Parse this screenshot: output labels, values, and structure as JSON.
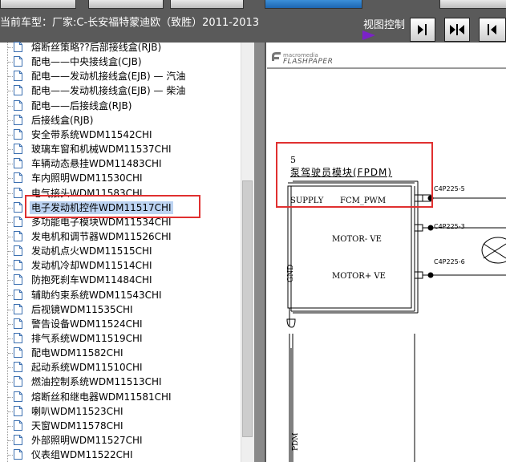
{
  "header": {
    "vehicle_text": "当前车型：厂家:C-长安福特蒙迪欧（致胜）2011-2013",
    "view_control_label": "视图控制"
  },
  "tree": {
    "items": [
      {
        "label": "熔断丝策略??后部接线盒(RJB)"
      },
      {
        "label": "配电——中央接线盒(CJB)"
      },
      {
        "label": "配电——发动机接线盒(EJB) — 汽油"
      },
      {
        "label": "配电——发动机接线盒(EJB) — 柴油"
      },
      {
        "label": "配电——后接线盒(RJB)"
      },
      {
        "label": "后接线盒(RJB)"
      },
      {
        "label": "安全带系统WDM11542CHI"
      },
      {
        "label": "玻璃车窗和机械WDM11537CHI"
      },
      {
        "label": "车辆动态悬挂WDM11483CHI"
      },
      {
        "label": "车内照明WDM11530CHI"
      },
      {
        "label": "电气接头WDM11583CHI"
      },
      {
        "label": "电子发动机控件WDM11517CHI",
        "selected": true
      },
      {
        "label": "多功能电子模块WDM11534CHI"
      },
      {
        "label": "发电机和调节器WDM11526CHI"
      },
      {
        "label": "发动机点火WDM11515CHI"
      },
      {
        "label": "发动机冷却WDM11514CHI"
      },
      {
        "label": "防抱死刹车WDM11484CHI"
      },
      {
        "label": "辅助约束系统WDM11543CHI"
      },
      {
        "label": "后视镜WDM11535CHI"
      },
      {
        "label": "警告设备WDM11524CHI"
      },
      {
        "label": "排气系统WDM11519CHI"
      },
      {
        "label": "配电WDM11582CHI"
      },
      {
        "label": "起动系统WDM11510CHI"
      },
      {
        "label": "燃油控制系统WDM11513CHI"
      },
      {
        "label": "熔断丝和继电器WDM11581CHI"
      },
      {
        "label": "喇叭WDM11523CHI"
      },
      {
        "label": "天窗WDM11578CHI"
      },
      {
        "label": "外部照明WDM11527CHI"
      },
      {
        "label": "仪表组WDM11522CHI"
      }
    ]
  },
  "viewer": {
    "logo_small": "macromedia",
    "logo_big": "FLASHPAPER",
    "diagram": {
      "pin_number": "5",
      "module_title": "泵驾驶员模块(FPDM)",
      "supply_label": "SUPPLY",
      "fcm_pwm_label": "FCM_PWM",
      "motor_minus_label": "MOTOR- VE",
      "motor_plus_label": "MOTOR+ VE",
      "gnd_label": "GND",
      "pdm_label": "PDM",
      "connector_1": "C4P225-5",
      "connector_2": "C4P225-3",
      "connector_3": "C4P225-6"
    }
  },
  "colors": {
    "header_bg": "#5a5a5a",
    "selection_bg": "#bcd3f2",
    "highlight_red": "#e03030",
    "play_icon": "#7b22c8"
  }
}
